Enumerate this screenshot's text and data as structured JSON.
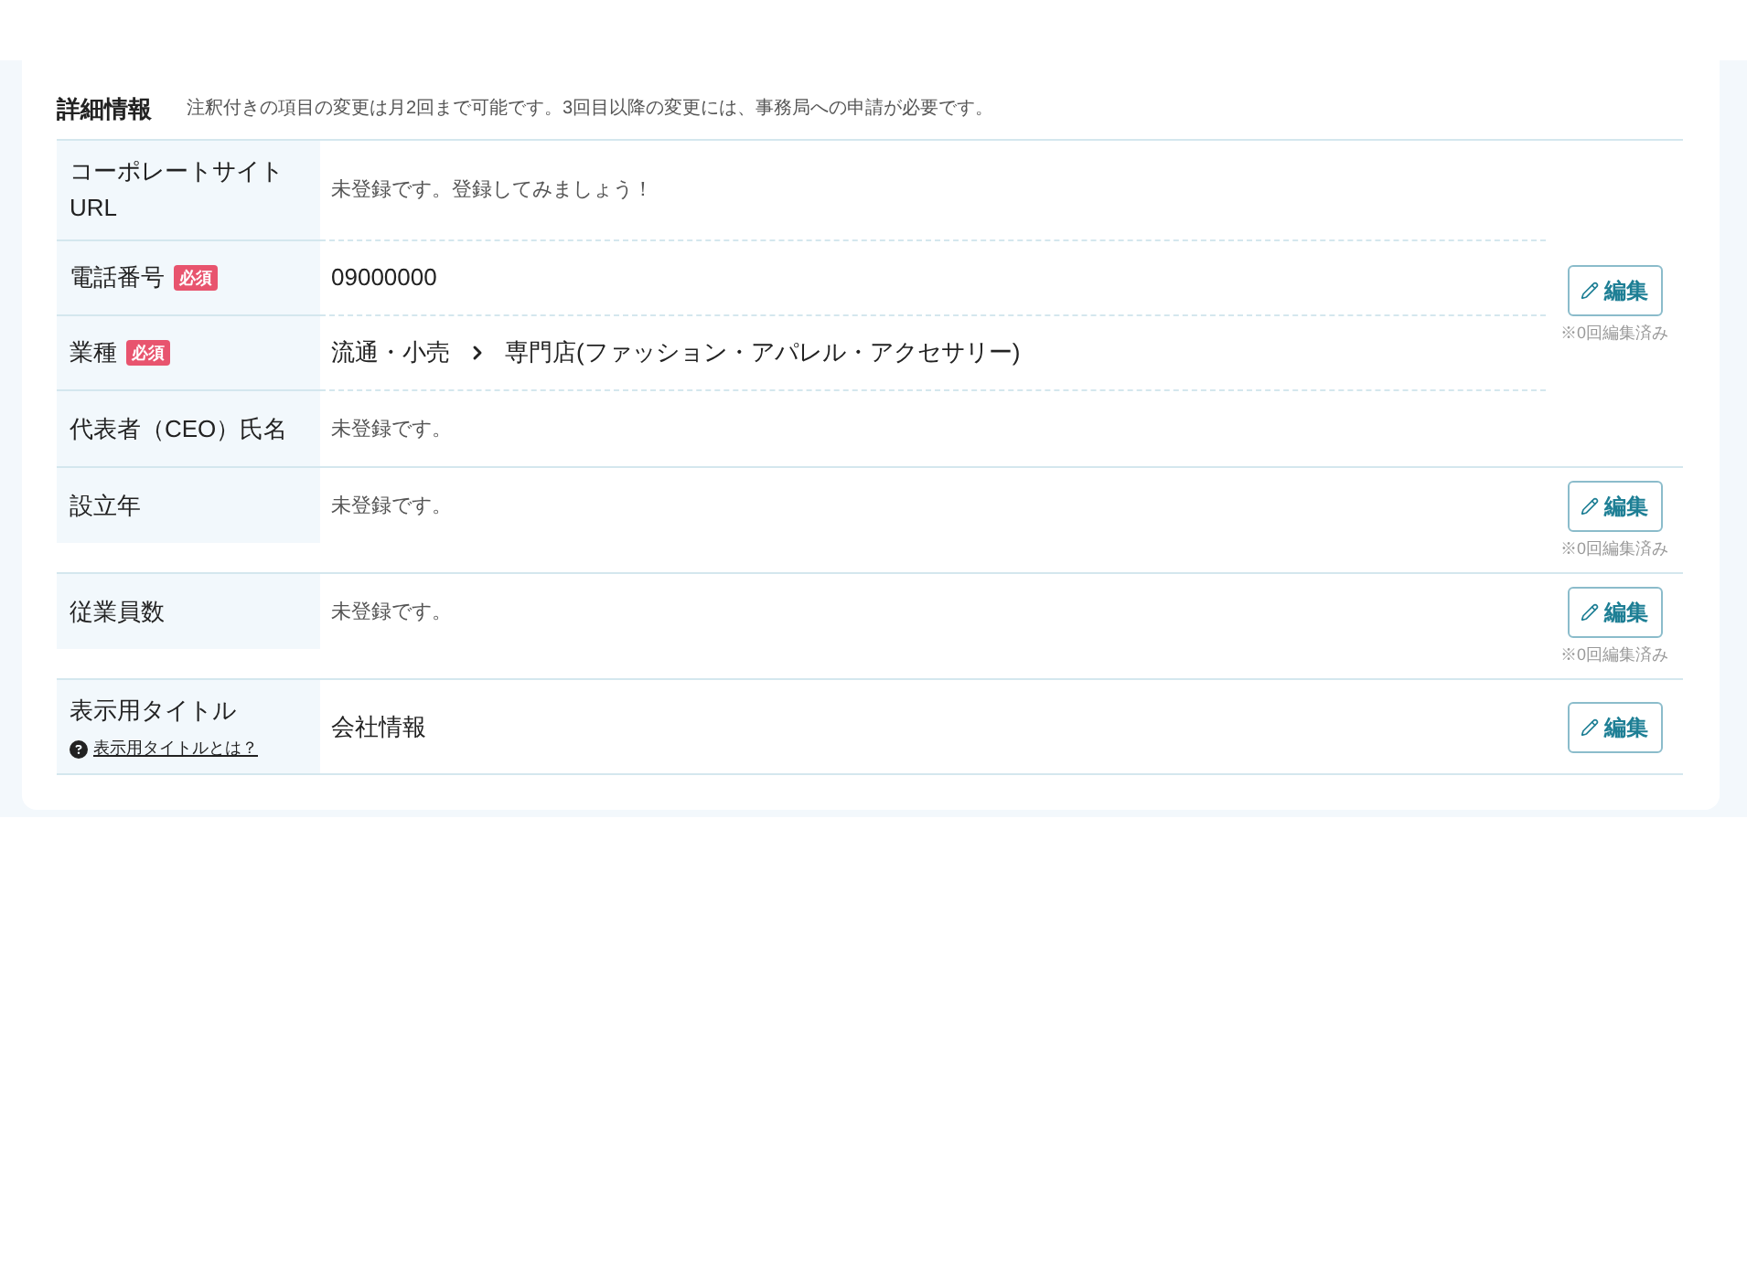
{
  "section": {
    "title": "詳細情報",
    "note": "注釈付きの項目の変更は月2回まで可能です。3回目以降の変更には、事務局への申請が必要です。"
  },
  "groups": [
    {
      "rows": [
        {
          "label": "コーポレートサイトURL",
          "value": {
            "kind": "unregistered",
            "text": "未登録です。登録してみましょう！"
          }
        },
        {
          "label": "電話番号",
          "badge": "必須",
          "value": {
            "kind": "text",
            "text": "09000000"
          }
        },
        {
          "label": "業種",
          "badge": "必須",
          "value": {
            "kind": "path",
            "parts": [
              "流通・小売",
              "専門店(ファッション・アパレル・アクセサリー)"
            ]
          }
        },
        {
          "label": "代表者（CEO）氏名",
          "value": {
            "kind": "unregistered",
            "text": "未登録です。"
          }
        }
      ],
      "edit_button": "編集",
      "edit_note": "※0回編集済み"
    },
    {
      "rows": [
        {
          "label": "設立年",
          "value": {
            "kind": "unregistered",
            "text": "未登録です。"
          }
        }
      ],
      "edit_button": "編集",
      "edit_note": "※0回編集済み"
    },
    {
      "rows": [
        {
          "label": "従業員数",
          "value": {
            "kind": "unregistered",
            "text": "未登録です。"
          }
        }
      ],
      "edit_button": "編集",
      "edit_note": "※0回編集済み"
    },
    {
      "rows": [
        {
          "label": "表示用タイトル",
          "help": {
            "text": "表示用タイトルとは？"
          },
          "value": {
            "kind": "text",
            "text": "会社情報"
          }
        }
      ],
      "edit_button": "編集"
    }
  ]
}
